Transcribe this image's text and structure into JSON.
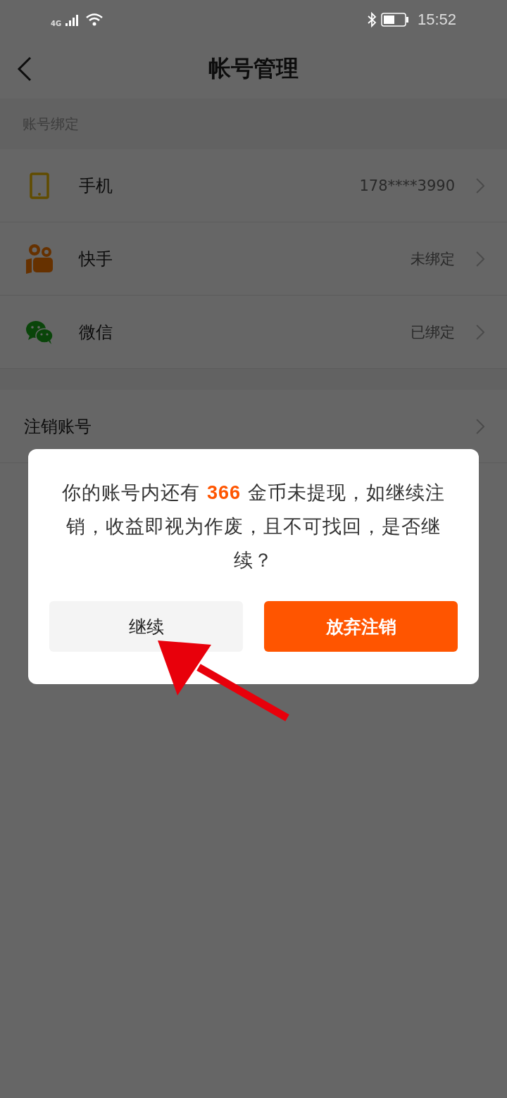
{
  "status_bar": {
    "network": "4G",
    "time": "15:52"
  },
  "header": {
    "title": "帐号管理"
  },
  "section": {
    "label": "账号绑定"
  },
  "bindings": [
    {
      "kind": "phone",
      "name": "手机",
      "value": "178****3990"
    },
    {
      "kind": "kuaishou",
      "name": "快手",
      "value": "未绑定"
    },
    {
      "kind": "wechat",
      "name": "微信",
      "value": "已绑定"
    }
  ],
  "cancel_row": {
    "label": "注销账号"
  },
  "dialog": {
    "message": "你的账号内还有 **366** 金币未提现，如继续注销，收益即视为作废，且不可找回，是否继续？",
    "buttons": [
      {
        "label": "继续",
        "kind": "secondary"
      },
      {
        "label": "放弃注销",
        "kind": "primary"
      }
    ]
  }
}
